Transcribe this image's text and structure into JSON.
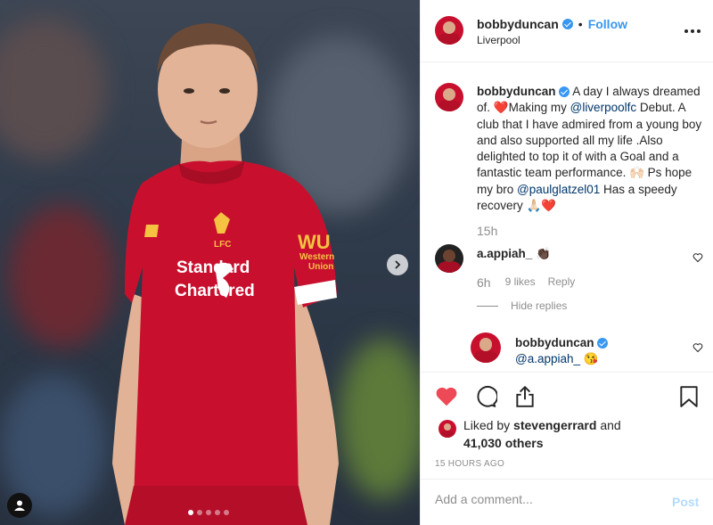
{
  "header": {
    "username": "bobbyduncan",
    "bullet": "•",
    "follow_label": "Follow",
    "location": "Liverpool"
  },
  "photo": {
    "jersey_sponsor_line1": "Standard",
    "jersey_sponsor_line2": "Chartered",
    "badge_text": "LFC",
    "sleeve_logo": "WU",
    "sleeve_text1": "Western",
    "sleeve_text2": "Union",
    "carousel_slides": 5,
    "carousel_active": 1
  },
  "caption": {
    "username": "bobbyduncan",
    "part1": "A day I always dreamed of. ",
    "heart1": "❤️",
    "part2": "Making my ",
    "mention1": "@liverpoolfc",
    "part3": " Debut. A club that I have admired from a young boy and also supported all my life .Also delighted to top it of with a Goal and a fantastic team performance. ",
    "emoji_hands": "🙌🏻",
    "part4": " Ps hope my bro ",
    "mention2": "@paulglatzel01",
    "part5": " Has a speedy recovery ",
    "emoji_pray": "🙏🏻",
    "heart2": "❤️",
    "time": "15h"
  },
  "comment1": {
    "username": "a.appiah_",
    "text": "👏🏿",
    "time": "6h",
    "likes": "9 likes",
    "reply": "Reply",
    "hide_replies": "Hide replies"
  },
  "comment2": {
    "username": "bobbyduncan",
    "mention": "@a.appiah_",
    "emoji": "😘"
  },
  "likes": {
    "liked_by": "Liked by",
    "user": "stevengerrard",
    "and": "and",
    "count": "41,030 others"
  },
  "posted": "15 HOURS AGO",
  "add_comment": {
    "placeholder": "Add a comment...",
    "post_label": "Post"
  },
  "colors": {
    "accent": "#3897f0",
    "like_red": "#ed4956",
    "kit_red": "#c8102e"
  }
}
